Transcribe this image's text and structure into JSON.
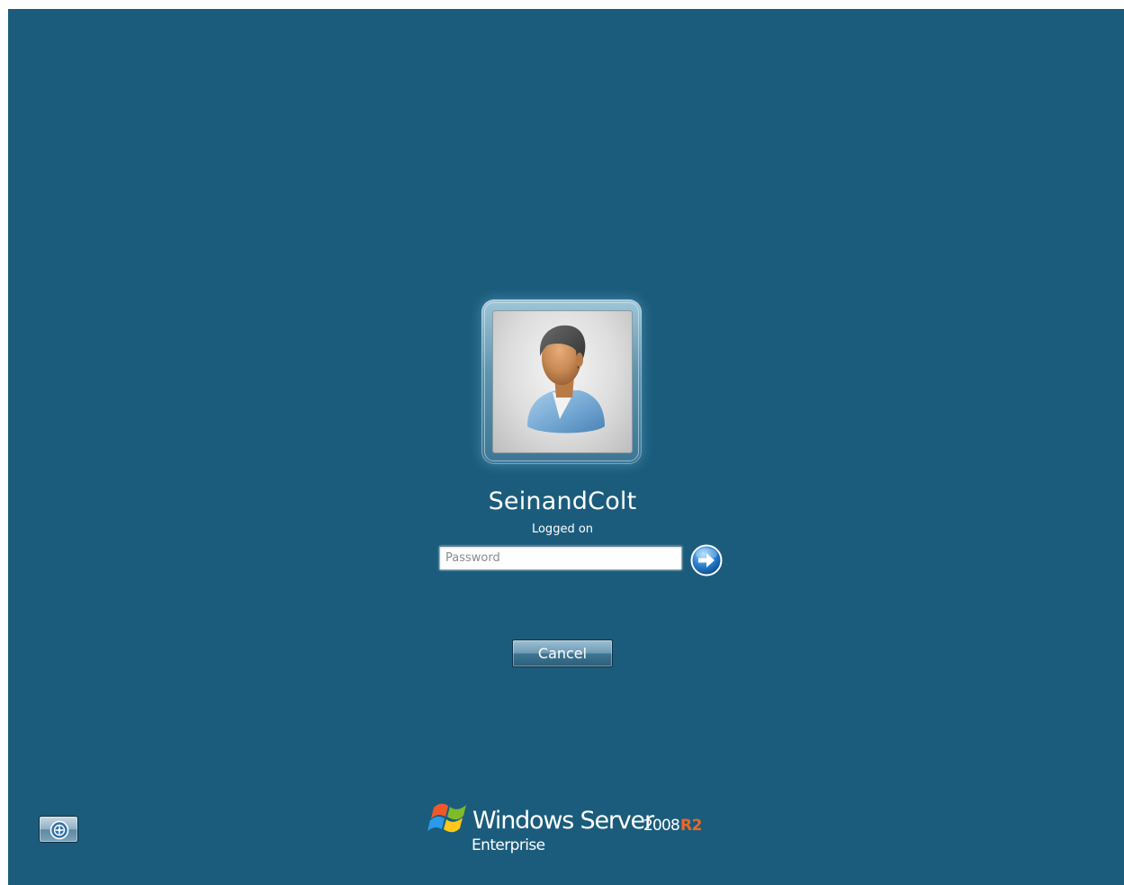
{
  "user": {
    "name": "SeinandColt",
    "status": "Logged on",
    "avatar_icon": "user-avatar-icon"
  },
  "password_field": {
    "value": "",
    "placeholder": "Password"
  },
  "buttons": {
    "submit_icon": "arrow-right-icon",
    "cancel_label": "Cancel",
    "ease_of_access_icon": "ease-of-access-icon"
  },
  "branding": {
    "product": "Windows Server",
    "version": "2008",
    "release": "R2",
    "edition": "Enterprise",
    "logo_icon": "windows-flag-icon"
  },
  "colors": {
    "background": "#1b5c7c",
    "r2_accent": "#e8692a",
    "text": "#ffffff"
  }
}
